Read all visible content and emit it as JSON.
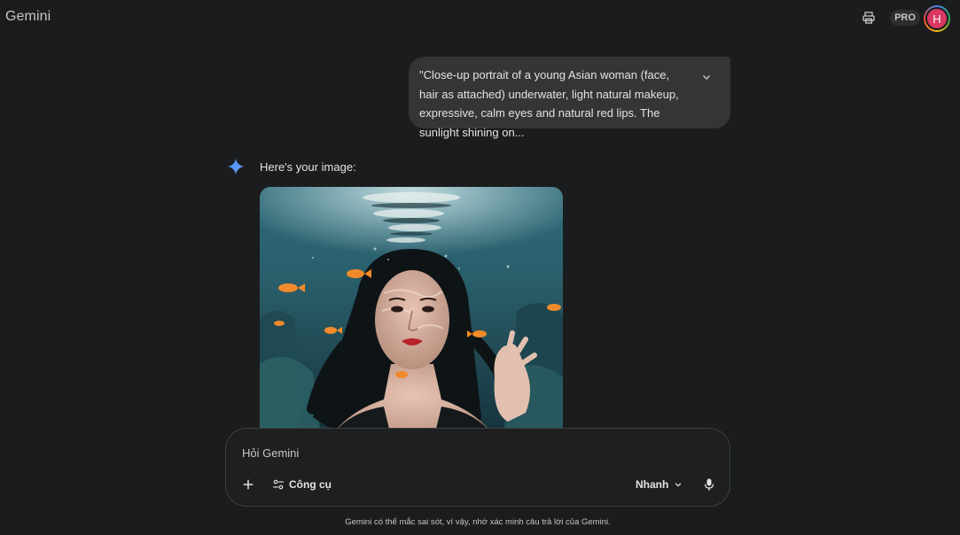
{
  "header": {
    "brand": "Gemini",
    "pro_badge": "PRO",
    "avatar_initial": "H"
  },
  "conversation": {
    "user_message": "\"Close-up portrait of a young Asian woman (face, hair as attached) underwater, light natural makeup, expressive, calm eyes and natural red lips. The sunlight shining on...",
    "response_text": "Here's your image:"
  },
  "input": {
    "placeholder": "Hỏi Gemini",
    "tools_label": "Công cụ",
    "model_label": "Nhanh"
  },
  "footer": {
    "disclaimer": "Gemini có thể mắc sai sót, vì vậy, nhớ xác minh câu trả lời của Gemini."
  },
  "colors": {
    "background": "#1b1c1d",
    "bubble": "#333537",
    "accent_blue": "#4285f4",
    "avatar": "#d93862"
  }
}
